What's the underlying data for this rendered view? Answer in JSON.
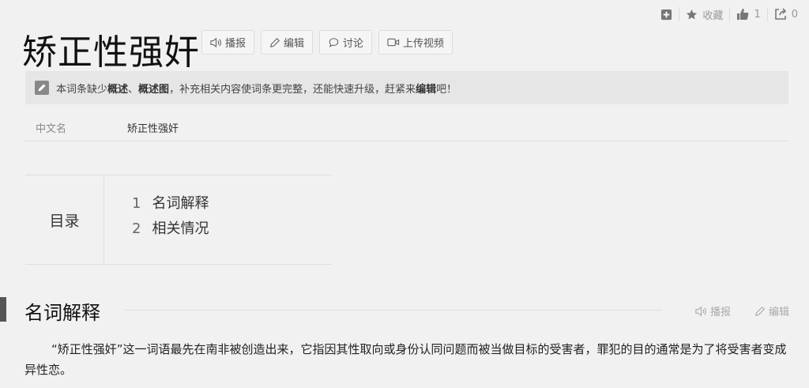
{
  "topbar": {
    "favorite_label": "收藏",
    "like_count": "1",
    "share_count": "0"
  },
  "title": "矫正性强奸",
  "actions": {
    "play": "播报",
    "edit": "编辑",
    "discuss": "讨论",
    "upload_video": "上传视频"
  },
  "notice": {
    "prefix": "本词条缺少",
    "item1": "概述",
    "sep": "、",
    "item2": "概述图",
    "middle": "，补充相关内容使词条更完整，还能快速升级，赶紧来",
    "link": "编辑",
    "suffix": "吧！"
  },
  "info": {
    "key": "中文名",
    "value": "矫正性强奸"
  },
  "toc": {
    "label": "目录",
    "items": [
      {
        "num": "1",
        "text": "名词解释"
      },
      {
        "num": "2",
        "text": "相关情况"
      }
    ]
  },
  "section": {
    "title": "名词解释",
    "play": "播报",
    "edit": "编辑",
    "paragraph": "“矫正性强奸”这一词语最先在南非被创造出来，它指因其性取向或身份认同问题而被当做目标的受害者，罪犯的目的通常是为了将受害者变成异性恋。"
  }
}
